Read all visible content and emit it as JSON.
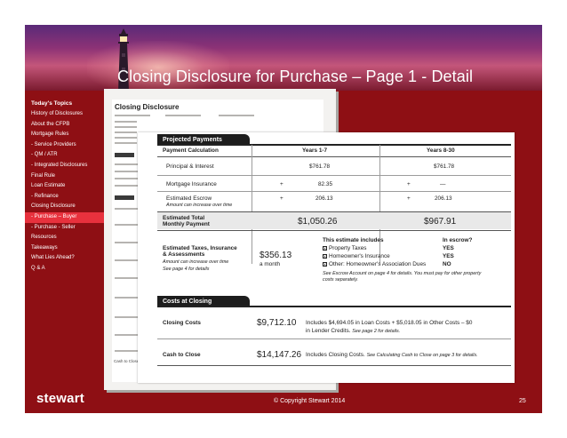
{
  "slide": {
    "title": "Closing Disclosure for Purchase – Page 1 - Detail",
    "footer": {
      "logo": "stewart",
      "copyright": "© Copyright Stewart 2014",
      "page_number": "25"
    }
  },
  "sidebar": {
    "heading": "Today's Topics",
    "items": [
      {
        "label": "History of Disclosures"
      },
      {
        "label": "About the CFPB"
      },
      {
        "label": "Mortgage Rules"
      },
      {
        "label": " - Service Providers"
      },
      {
        "label": " - QM / ATR"
      },
      {
        "label": " - Integrated Disclosures"
      },
      {
        "label": "Final Rule"
      },
      {
        "label": "Loan Estimate"
      },
      {
        "label": " - Refinance"
      },
      {
        "label": "Closing Disclosure"
      },
      {
        "label": " - Purchase – Buyer",
        "active": true
      },
      {
        "label": " - Purchase - Seller"
      },
      {
        "label": "Resources"
      },
      {
        "label": "Takeaways"
      },
      {
        "label": "What Lies Ahead?"
      },
      {
        "label": "Q & A"
      }
    ]
  },
  "background_form": {
    "title": "Closing Disclosure",
    "bottom_amount": "$14,147.26",
    "bottom_label": "Cash to Close"
  },
  "projected_payments": {
    "section_title": "Projected Payments",
    "column_label": "Payment Calculation",
    "year_headers": [
      "Years 1-7",
      "Years 8-30"
    ],
    "rows": [
      {
        "label": "Principal & Interest",
        "col1": "$761.78",
        "col2": "$761.78"
      },
      {
        "label": "Mortgage Insurance",
        "op1": "+",
        "col1": "82.35",
        "op2": "+",
        "col2": "—"
      },
      {
        "label": "Estimated Escrow",
        "note": "Amount can increase over time",
        "op1": "+",
        "col1": "206.13",
        "op2": "+",
        "col2": "206.13"
      }
    ],
    "total": {
      "label_line1": "Estimated Total",
      "label_line2": "Monthly Payment",
      "col1": "$1,050.26",
      "col2": "$967.91"
    },
    "taxes": {
      "label_line1": "Estimated Taxes, Insurance",
      "label_line2": "& Assessments",
      "note1": "Amount can increase over time",
      "note2": "See page 4 for details",
      "amount": "$356.13",
      "period": "a month",
      "includes_header": "This estimate includes",
      "escrow_header": "In escrow?",
      "items": [
        {
          "label": "Property Taxes",
          "escrow": "YES"
        },
        {
          "label": "Homeowner's Insurance",
          "escrow": "YES"
        },
        {
          "label": "Other: Homeowner's Association Dues",
          "escrow": "NO"
        }
      ],
      "footnote_line1": "See Escrow Account on page 4 for details. You must pay for other property",
      "footnote_line2": "costs separately."
    }
  },
  "costs_at_closing": {
    "section_title": "Costs at Closing",
    "closing_costs": {
      "label": "Closing Costs",
      "amount": "$9,712.10",
      "desc_line1": "Includes $4,694.05 in Loan Costs + $5,018.05 in Other Costs – $0",
      "desc_line2": "in Lender Credits.",
      "desc_ref": "See page 2 for details."
    },
    "cash_to_close": {
      "label": "Cash to Close",
      "amount": "$14,147.26",
      "desc": "Includes Closing Costs.",
      "desc_ref": "See Calculating Cash to Close on page 3 for details."
    }
  }
}
